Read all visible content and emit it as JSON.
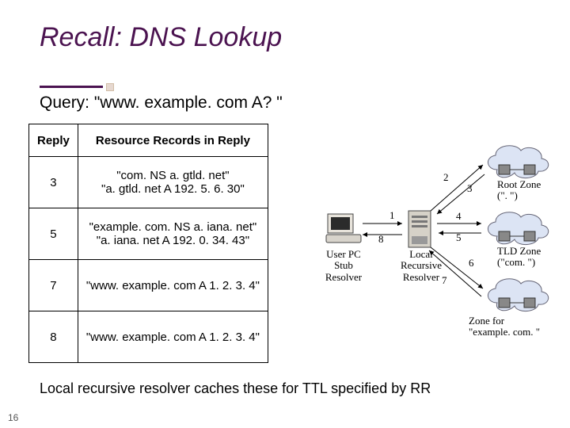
{
  "title": "Recall:  DNS Lookup",
  "subtitle": "Query: \"www. example. com A? \"",
  "table": {
    "headers": [
      "Reply",
      "Resource Records in Reply"
    ],
    "rows": [
      {
        "reply": "3",
        "rr": "\"com. NS a. gtld. net\"\n\"a. gtld. net A 192. 5. 6. 30\""
      },
      {
        "reply": "5",
        "rr": "\"example. com. NS a. iana. net\"\n\"a. iana. net A 192. 0. 34. 43\""
      },
      {
        "reply": "7",
        "rr": "\"www. example. com A 1. 2. 3. 4\""
      },
      {
        "reply": "8",
        "rr": "\"www. example. com A 1. 2. 3. 4\""
      }
    ]
  },
  "caption": "Local recursive resolver caches these for TTL specified by RR",
  "page_number": "16",
  "diagram": {
    "nodes": {
      "user_pc": "User PC\nStub\nResolver",
      "local_resolver": "Local\nRecursive\nResolver",
      "root_zone": "Root Zone\n(\". \")",
      "tld_zone": "TLD Zone\n(\"com. \")",
      "example_zone": "Zone for\n\"example. com. \""
    },
    "edges": [
      "1",
      "2",
      "3",
      "4",
      "5",
      "6",
      "7",
      "8"
    ]
  }
}
